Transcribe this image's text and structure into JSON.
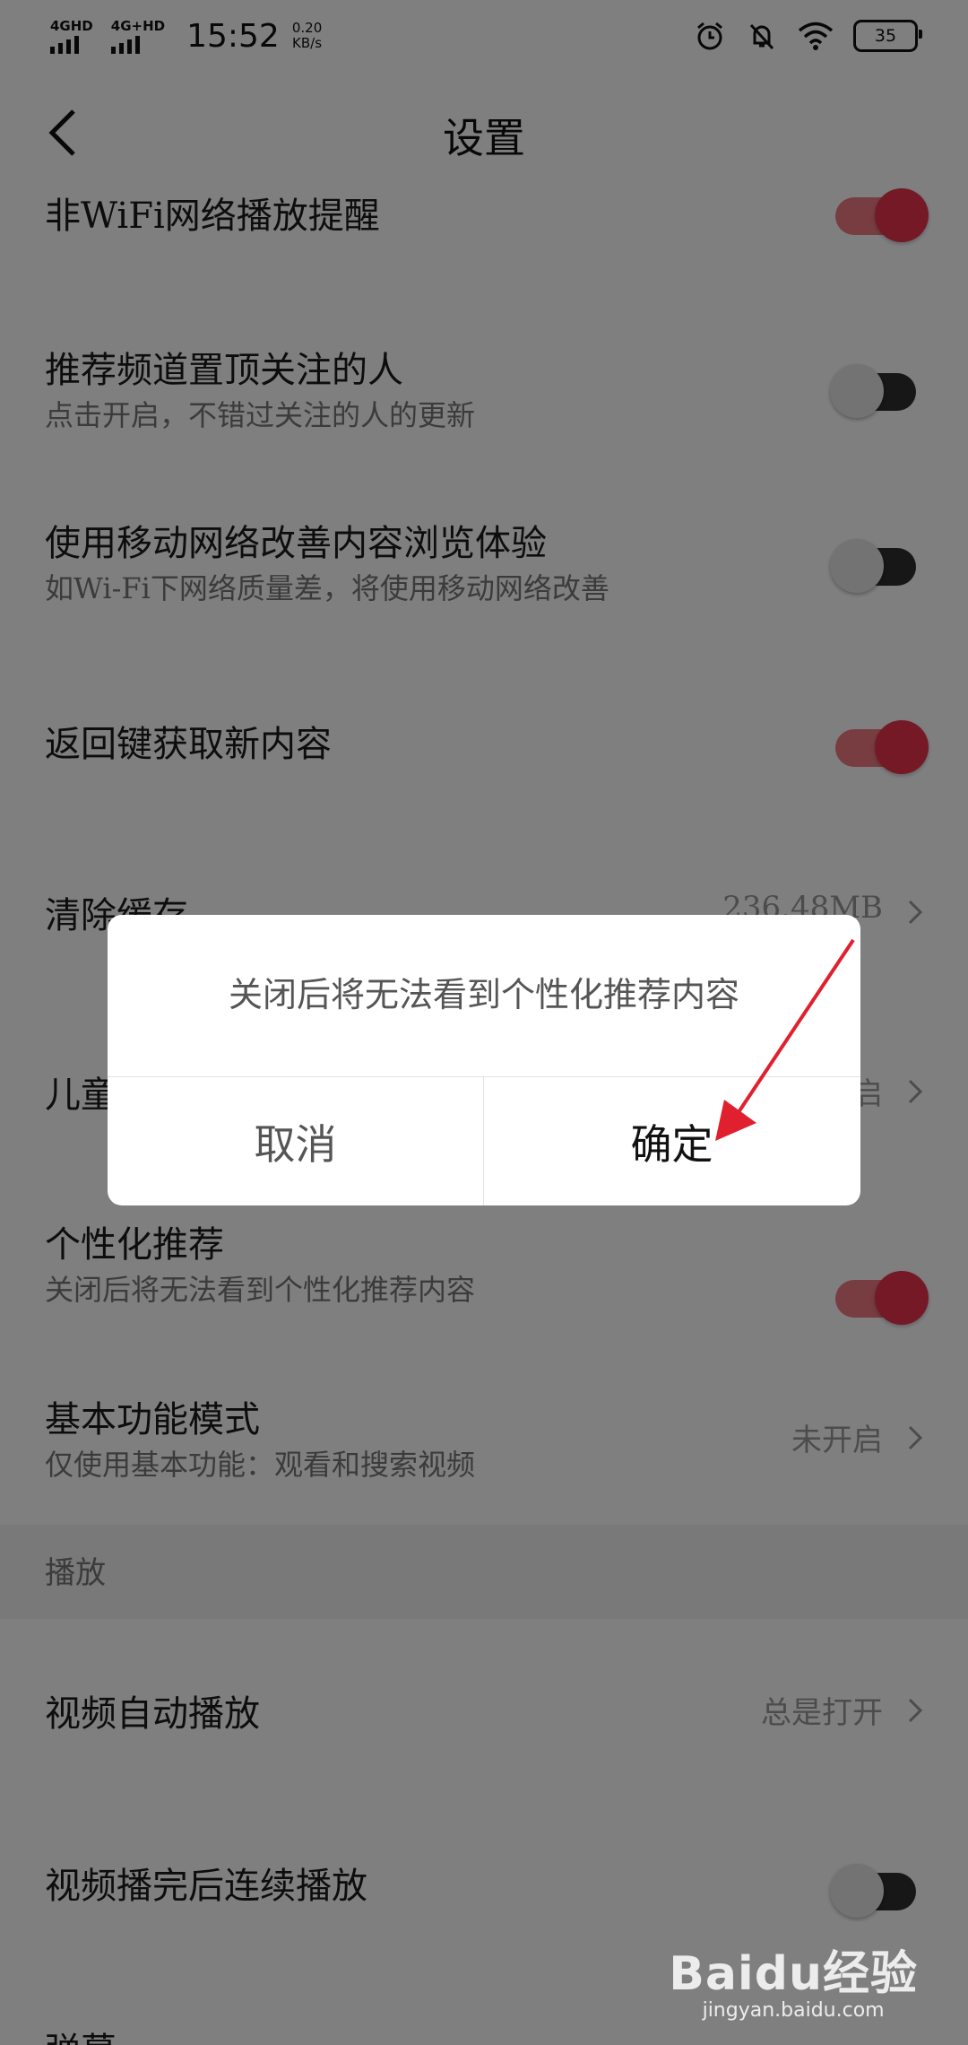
{
  "status_bar": {
    "signal1": "4GHD",
    "signal2": "4G+HD",
    "time": "15:52",
    "speed_value": "0.20",
    "speed_unit": "KB/s",
    "battery": "35",
    "icons": [
      "alarm-icon",
      "bell-muted-icon",
      "wifi-icon",
      "battery-icon"
    ]
  },
  "header": {
    "title": "设置",
    "back_icon": "chevron-left-icon"
  },
  "settings": {
    "wifi_reminder": {
      "title": "非WiFi网络播放提醒",
      "on": true
    },
    "pin_followed": {
      "title": "推荐频道置顶关注的人",
      "subtitle": "点击开启，不错过关注的人的更新",
      "on": false
    },
    "mobile_network": {
      "title": "使用移动网络改善内容浏览体验",
      "subtitle": "如Wi-Fi下网络质量差，将使用移动网络改善",
      "on": false
    },
    "back_refresh": {
      "title": "返回键获取新内容",
      "on": true
    },
    "clear_cache": {
      "title": "清除缓存",
      "value": "236.48MB"
    },
    "kids_mode": {
      "title": "儿童",
      "value": "启"
    },
    "personalized": {
      "title": "个性化推荐",
      "subtitle": "关闭后将无法看到个性化推荐内容",
      "on": true
    },
    "basic_mode": {
      "title": "基本功能模式",
      "subtitle": "仅使用基本功能：观看和搜索视频",
      "value": "未开启"
    }
  },
  "section_play": {
    "label": "播放"
  },
  "play": {
    "autoplay": {
      "title": "视频自动播放",
      "value": "总是打开"
    },
    "continuous": {
      "title": "视频播完后连续播放",
      "on": false
    },
    "partial": {
      "title": "弹幕"
    }
  },
  "dialog": {
    "message": "关闭后将无法看到个性化推荐内容",
    "cancel": "取消",
    "confirm": "确定"
  },
  "colors": {
    "accent": "#e8334a",
    "accent_track": "#f07a82",
    "annotation": "#e0202e"
  },
  "watermark": {
    "logo": "Baidu经验",
    "site": "jingyan.baidu.com"
  }
}
